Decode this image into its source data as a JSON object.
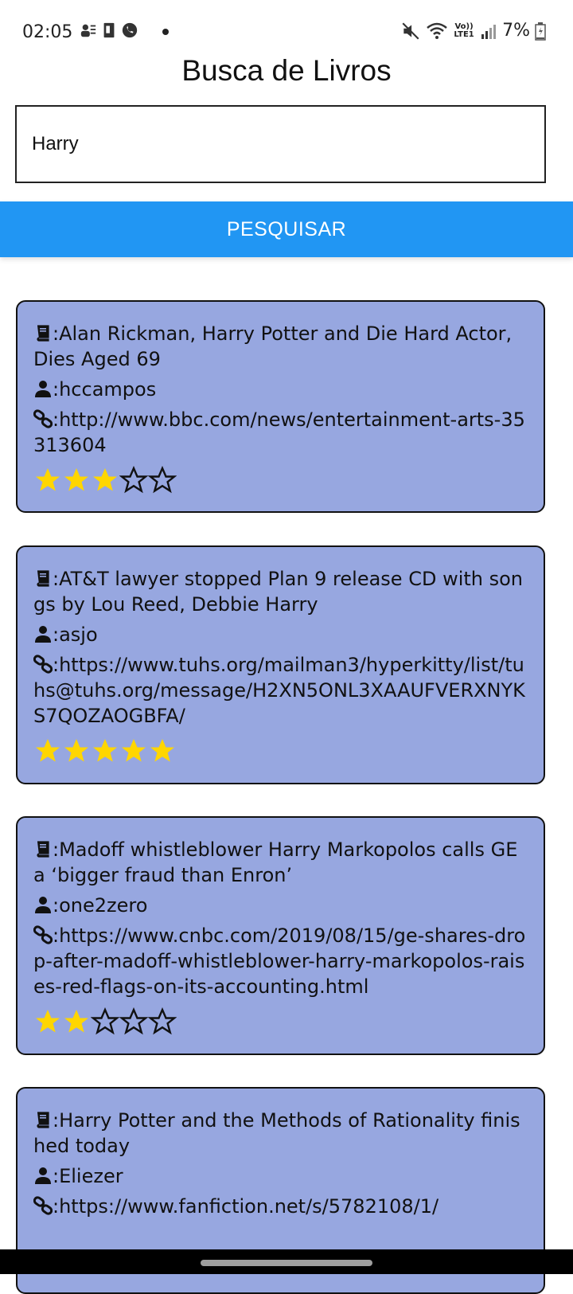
{
  "status_bar": {
    "time": "02:05",
    "battery": "7%",
    "network": "Vo)) LTE1",
    "icons": [
      "profile-icon",
      "notes-icon",
      "whatsapp-icon",
      "mute-icon",
      "wifi-icon",
      "signal-icon",
      "battery-icon"
    ]
  },
  "app": {
    "title": "Busca de Livros"
  },
  "search": {
    "value": "Harry",
    "button_label": "PESQUISAR"
  },
  "results": [
    {
      "title": ":Alan Rickman, Harry Potter and Die Hard Actor, Dies Aged 69",
      "author": ":hccampos",
      "url": ":http://www.bbc.com/news/entertainment-arts-35313604",
      "rating": 3,
      "max_rating": 5
    },
    {
      "title": ":AT&T lawyer stopped Plan 9 release CD with songs by Lou Reed, Debbie Harry",
      "author": ":asjo",
      "url": ":https://www.tuhs.org/mailman3/hyperkitty/list/tuhs@tuhs.org/message/H2XN5ONL3XAAUFVERXNYKS7QOZAOGBFA/",
      "rating": 5,
      "max_rating": 5
    },
    {
      "title": ":Madoff whistleblower Harry Markopolos calls GE a ‘bigger fraud than Enron’",
      "author": ":one2zero",
      "url": ":https://www.cnbc.com/2019/08/15/ge-shares-drop-after-madoff-whistleblower-harry-markopolos-raises-red-flags-on-its-accounting.html",
      "rating": 2,
      "max_rating": 5
    },
    {
      "title": ":Harry Potter and the Methods of Rationality finished today",
      "author": ":Eliezer",
      "url": ":https://www.fanfiction.net/s/5782108/1/",
      "rating": null,
      "max_rating": 5
    }
  ],
  "colors": {
    "accent": "#2196f3",
    "card_background": "#97a7e0",
    "star_filled": "#ffd600",
    "star_empty_stroke": "#111111"
  }
}
